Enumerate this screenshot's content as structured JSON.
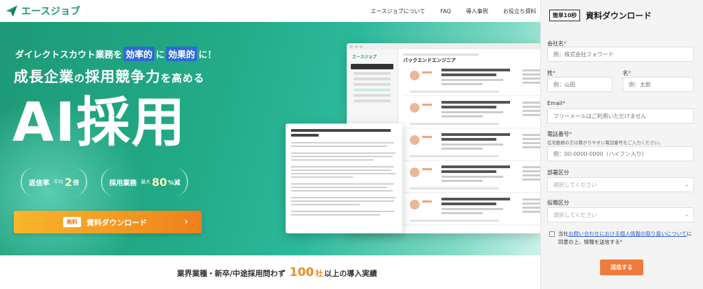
{
  "header": {
    "logo_text": "エースジョブ",
    "nav": [
      "エースジョブについて",
      "FAQ",
      "導入事例",
      "お役立ち資料"
    ]
  },
  "hero": {
    "tagline_pre": "ダイレクトスカウト業務を",
    "tagline_box1": "効率的",
    "tagline_mid": "に",
    "tagline_box2": "効果的",
    "tagline_post": "に！",
    "headline_a": "成長企業",
    "headline_b": "の",
    "headline_c": "採用競争力",
    "headline_d": "を高める",
    "title": "AI採用",
    "badges": [
      {
        "label": "返信率",
        "sub": "平均",
        "value": "2",
        "unit": "倍"
      },
      {
        "label": "採用業務",
        "sub": "最大",
        "value": "80",
        "unit": "%減"
      }
    ],
    "cta": {
      "free": "無料",
      "label": "資料ダウンロード",
      "chevron": "›"
    }
  },
  "mockup": {
    "logo": "エースジョブ",
    "title": "バックエンドエンジニア"
  },
  "strip": {
    "pre": "業界業種・新卒/中途採用問わず",
    "num": "100",
    "unit": "社",
    "post": "以上の導入実績"
  },
  "form": {
    "pill": "簡単10秒",
    "title": "資料ダウンロード",
    "company_label": "会社名",
    "company_placeholder": "例：株式会社フォワード",
    "last_label": "姓",
    "last_placeholder": "例：山田",
    "first_label": "名",
    "first_placeholder": "例：太郎",
    "email_label": "Email",
    "email_placeholder": "フリーメールはご利用いただけません",
    "phone_label": "電話番号",
    "phone_help": "在宅勤務の方は繋がりやすい電話番号をご入力ください。",
    "phone_placeholder": "例：00-0000-0000（ハイフン入り）",
    "dept_label": "部署区分",
    "dept_placeholder": "選択してください",
    "role_label": "役職区分",
    "role_placeholder": "選択してください",
    "required_mark": "*",
    "consent_pre": "当社",
    "consent_link": "お問い合わせにおける個人情報の取り扱いについて",
    "consent_post": "に同意の上、情報を送信する",
    "submit": "送信する"
  }
}
